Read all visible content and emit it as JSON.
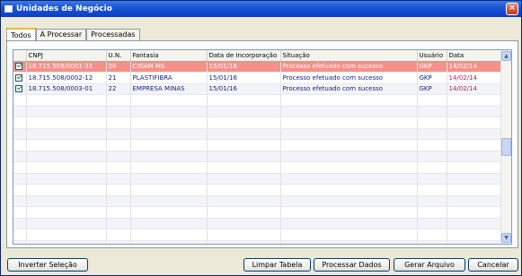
{
  "window": {
    "title": "Unidades de Negócio",
    "close_glyph": "×"
  },
  "tabs": [
    {
      "label": "Todos",
      "active": true
    },
    {
      "label": "A Processar",
      "active": false
    },
    {
      "label": "Processadas",
      "active": false
    }
  ],
  "grid": {
    "columns": [
      "",
      "CNPJ",
      "U.N.",
      "Fantasia",
      "Data de Incorporação",
      "Situação",
      "Usuário",
      "Data"
    ],
    "rows": [
      {
        "checked": true,
        "cnpj": "18.715.508/0001-31",
        "un": "20",
        "fantasia": "CIGAM MS",
        "data_incorporacao": "15/01/16",
        "situacao": "Processo efetuado com sucesso",
        "usuario": "GKP",
        "data": "14/02/14",
        "highlight": true
      },
      {
        "checked": true,
        "cnpj": "18.715.508/0002-12",
        "un": "21",
        "fantasia": "PLASTIFIBRA",
        "data_incorporacao": "15/01/16",
        "situacao": "Processo efetuado com sucesso",
        "usuario": "GKP",
        "data": "14/02/14",
        "highlight": false
      },
      {
        "checked": true,
        "cnpj": "18.715.508/0003-01",
        "un": "22",
        "fantasia": "EMPRESA MINAS",
        "data_incorporacao": "15/01/16",
        "situacao": "Processo efetuado com sucesso",
        "usuario": "GKP",
        "data": "14/02/14",
        "highlight": false
      }
    ],
    "scroll_up_glyph": "▲",
    "scroll_down_glyph": "▼"
  },
  "buttons": {
    "invert": "Inverter Seleção",
    "clear": "Limpar Tabela",
    "process": "Processar Dados",
    "generate": "Gerar Arquivo",
    "cancel": "Cancelar"
  },
  "colors": {
    "highlight_row": "#f5918a",
    "title_bar": "#1c55d6"
  }
}
